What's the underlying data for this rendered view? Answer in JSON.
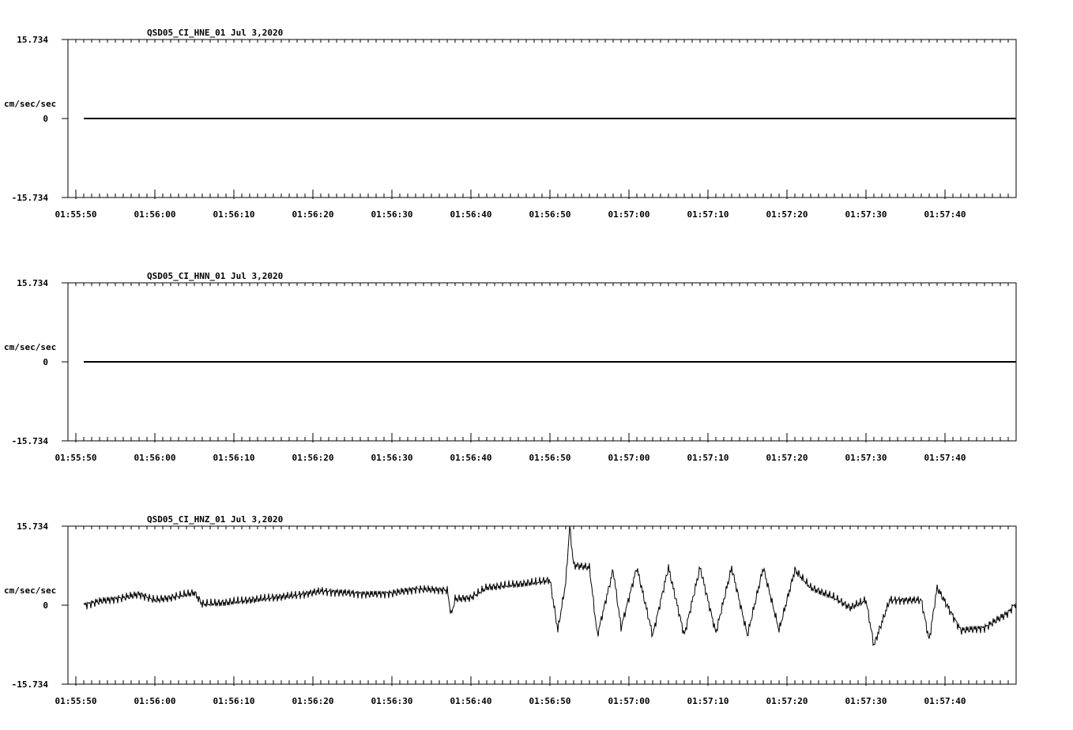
{
  "chart_data": [
    {
      "type": "line",
      "title": "QSD05_CI_HNE_01  Jul 3,2020",
      "ylabel": "cm/sec/sec",
      "ylim": [
        -15.734,
        15.734
      ],
      "y_tick_labels": [
        "15.734",
        "0",
        "-15.734"
      ],
      "x_tick_labels": [
        "01:55:50",
        "01:56:00",
        "01:56:10",
        "01:56:20",
        "01:56:30",
        "01:56:40",
        "01:56:50",
        "01:57:00",
        "01:57:10",
        "01:57:20",
        "01:57:30",
        "01:57:40"
      ],
      "xlim_seconds_into_minute_window": [
        0,
        0
      ],
      "series": [
        {
          "x": [
            "01:55:51",
            "01:57:49"
          ],
          "y": [
            0,
            0
          ]
        }
      ]
    },
    {
      "type": "line",
      "title": "QSD05_CI_HNN_01  Jul 3,2020",
      "ylabel": "cm/sec/sec",
      "ylim": [
        -15.734,
        15.734
      ],
      "y_tick_labels": [
        "15.734",
        "0",
        "-15.734"
      ],
      "x_tick_labels": [
        "01:55:50",
        "01:56:00",
        "01:56:10",
        "01:56:20",
        "01:56:30",
        "01:56:40",
        "01:56:50",
        "01:57:00",
        "01:57:10",
        "01:57:20",
        "01:57:30",
        "01:57:40"
      ],
      "series": [
        {
          "x": [
            "01:55:51",
            "01:57:49"
          ],
          "y": [
            0,
            0
          ]
        }
      ]
    },
    {
      "type": "line",
      "title": "QSD05_CI_HNZ_01  Jul 3,2020",
      "ylabel": "cm/sec/sec",
      "ylim": [
        -15.734,
        15.734
      ],
      "y_tick_labels": [
        "15.734",
        "0",
        "-15.734"
      ],
      "x_tick_labels": [
        "01:55:50",
        "01:56:00",
        "01:56:10",
        "01:56:20",
        "01:56:30",
        "01:56:40",
        "01:56:50",
        "01:57:00",
        "01:57:10",
        "01:57:20",
        "01:57:30",
        "01:57:40"
      ],
      "series": [
        {
          "x": [
            "01:55:51",
            "01:55:53",
            "01:55:56",
            "01:55:58",
            "01:56:00",
            "01:56:02",
            "01:56:05",
            "01:56:06",
            "01:56:09",
            "01:56:12",
            "01:56:15",
            "01:56:18",
            "01:56:21",
            "01:56:24",
            "01:56:27",
            "01:56:30",
            "01:56:33",
            "01:56:37",
            "01:56:37.5",
            "01:56:38",
            "01:56:40",
            "01:56:42",
            "01:56:45",
            "01:56:48",
            "01:56:50",
            "01:56:51",
            "01:56:52",
            "01:56:52.5",
            "01:56:53",
            "01:56:55",
            "01:56:56",
            "01:56:58",
            "01:56:59",
            "01:57:01",
            "01:57:03",
            "01:57:05",
            "01:57:07",
            "01:57:09",
            "01:57:11",
            "01:57:13",
            "01:57:15",
            "01:57:17",
            "01:57:19",
            "01:57:21",
            "01:57:23",
            "01:57:26",
            "01:57:28",
            "01:57:30",
            "01:57:31",
            "01:57:33",
            "01:57:35",
            "01:57:37",
            "01:57:38",
            "01:57:39",
            "01:57:42",
            "01:57:45",
            "01:57:48",
            "01:57:49"
          ],
          "y": [
            0,
            0.8,
            1.5,
            2.2,
            1.0,
            1.5,
            2.5,
            0.2,
            0.5,
            1.0,
            1.5,
            2.0,
            2.8,
            2.5,
            2.2,
            2.4,
            3.2,
            3.0,
            -2.0,
            1.2,
            1.5,
            3.5,
            4.0,
            4.5,
            5.0,
            -5.0,
            4.5,
            15.7,
            8.0,
            7.5,
            -6.0,
            7.0,
            -4.5,
            7.5,
            -6.0,
            7.5,
            -6.0,
            7.5,
            -5.5,
            7.5,
            -6.0,
            7.5,
            -5.0,
            7.0,
            3.5,
            1.5,
            -0.5,
            1.0,
            -8.0,
            1.0,
            1.0,
            1.0,
            -7.0,
            3.5,
            -5.0,
            -4.5,
            -1.5,
            0.5
          ]
        }
      ]
    }
  ]
}
